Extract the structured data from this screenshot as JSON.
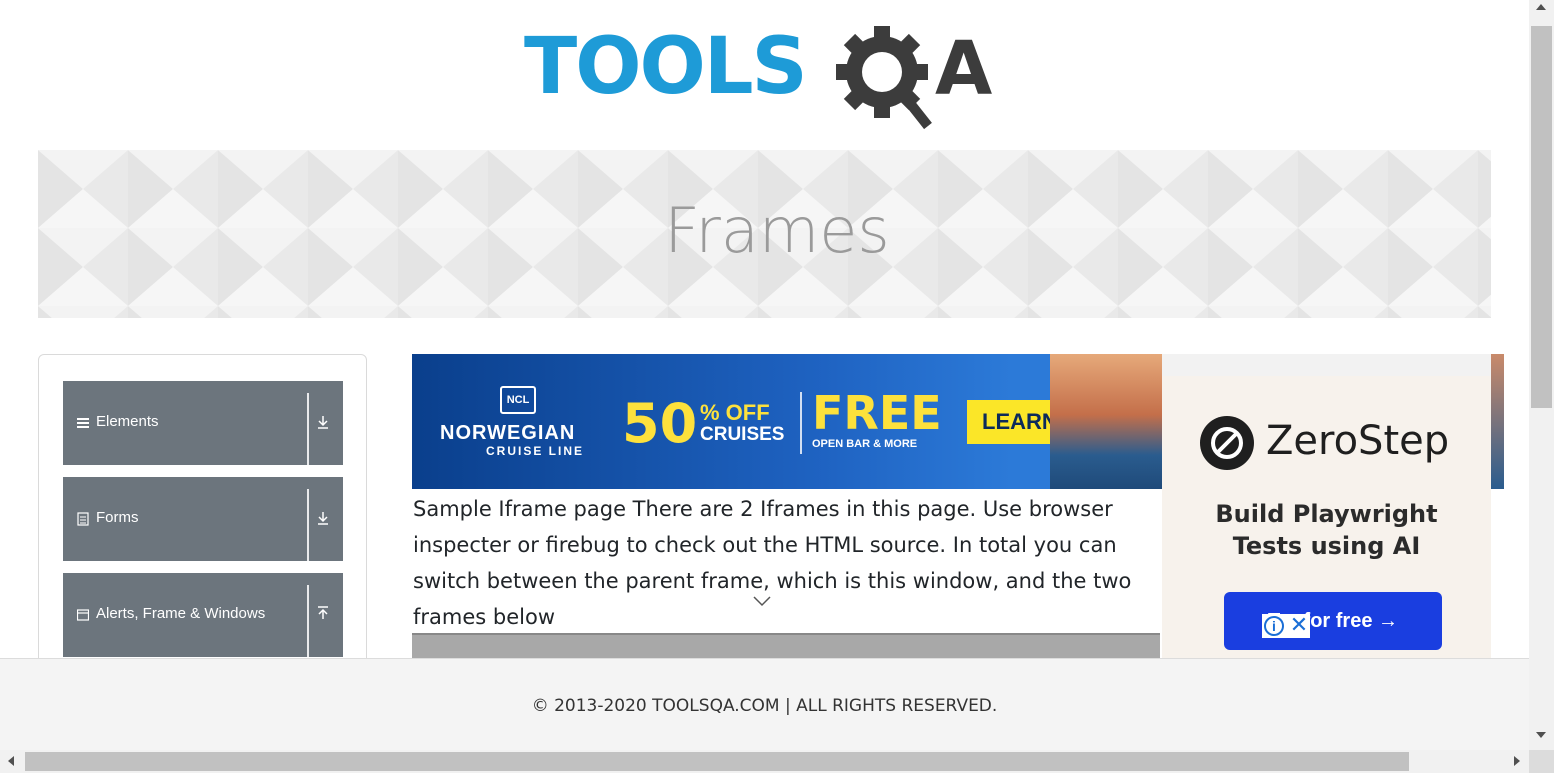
{
  "header": {
    "logo_text": "TOOLS",
    "logo_letter": "A"
  },
  "banner": {
    "title": "Frames"
  },
  "sidebar": {
    "groups": [
      {
        "label": "Elements",
        "icon": "hamburger-icon",
        "toggle_icon": "download-arrow-icon"
      },
      {
        "label": "Forms",
        "icon": "document-icon",
        "toggle_icon": "download-arrow-icon"
      },
      {
        "label": "Alerts, Frame & Windows",
        "icon": "window-icon",
        "toggle_icon": "upload-arrow-icon"
      }
    ]
  },
  "ad_top": {
    "brand_badge": "NCL",
    "brand_name": "NORWEGIAN",
    "brand_sub": "CRUISE LINE",
    "offer_number": "50",
    "offer_percent": "% OFF",
    "offer_cruises": "CRUISES",
    "offer_free": "FREE",
    "offer_extra": "OPEN BAR & MORE",
    "cta": "LEARN MORE"
  },
  "main": {
    "description": "Sample Iframe page There are 2 Iframes in this page. Use browser inspecter or firebug to check out the HTML source. In total you can switch between the parent frame, which is this window, and the two frames below"
  },
  "ad_side": {
    "brand": "ZeroStep",
    "tagline_line1": "Build Playwright",
    "tagline_line2": "Tests using AI",
    "cta": "Try for free →",
    "adchoices_info": "i",
    "adchoices_close": "✕"
  },
  "footer": {
    "copyright": "© 2013-2020 TOOLSQA.COM | ALL RIGHTS RESERVED."
  },
  "colors": {
    "brand_blue": "#1e9bd7",
    "brand_dark": "#3c3c3c",
    "menu_gray": "#6c757d",
    "cta_yellow": "#fbe628",
    "zerostep_blue": "#1a3ee0"
  }
}
